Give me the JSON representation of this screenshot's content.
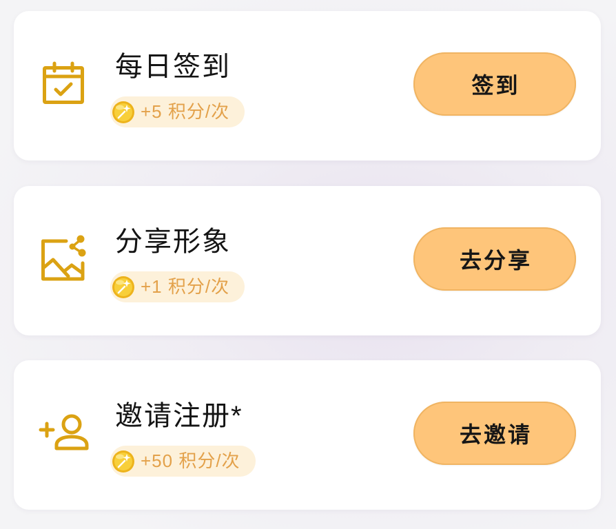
{
  "colors": {
    "accent": "#DBA213",
    "button_bg": "#FEC57A",
    "badge_bg": "#FDF1DA",
    "badge_text": "#E3A14A"
  },
  "tasks": [
    {
      "icon": "calendar-check-icon",
      "title": "每日签到",
      "reward_icon": "coin-icon",
      "reward": "+5 积分/次",
      "button_label": "签到"
    },
    {
      "icon": "image-share-icon",
      "title": "分享形象",
      "reward_icon": "coin-icon",
      "reward": "+1 积分/次",
      "button_label": "去分享"
    },
    {
      "icon": "add-user-icon",
      "title": "邀请注册*",
      "reward_icon": "coin-icon",
      "reward": "+50 积分/次",
      "button_label": "去邀请"
    }
  ]
}
